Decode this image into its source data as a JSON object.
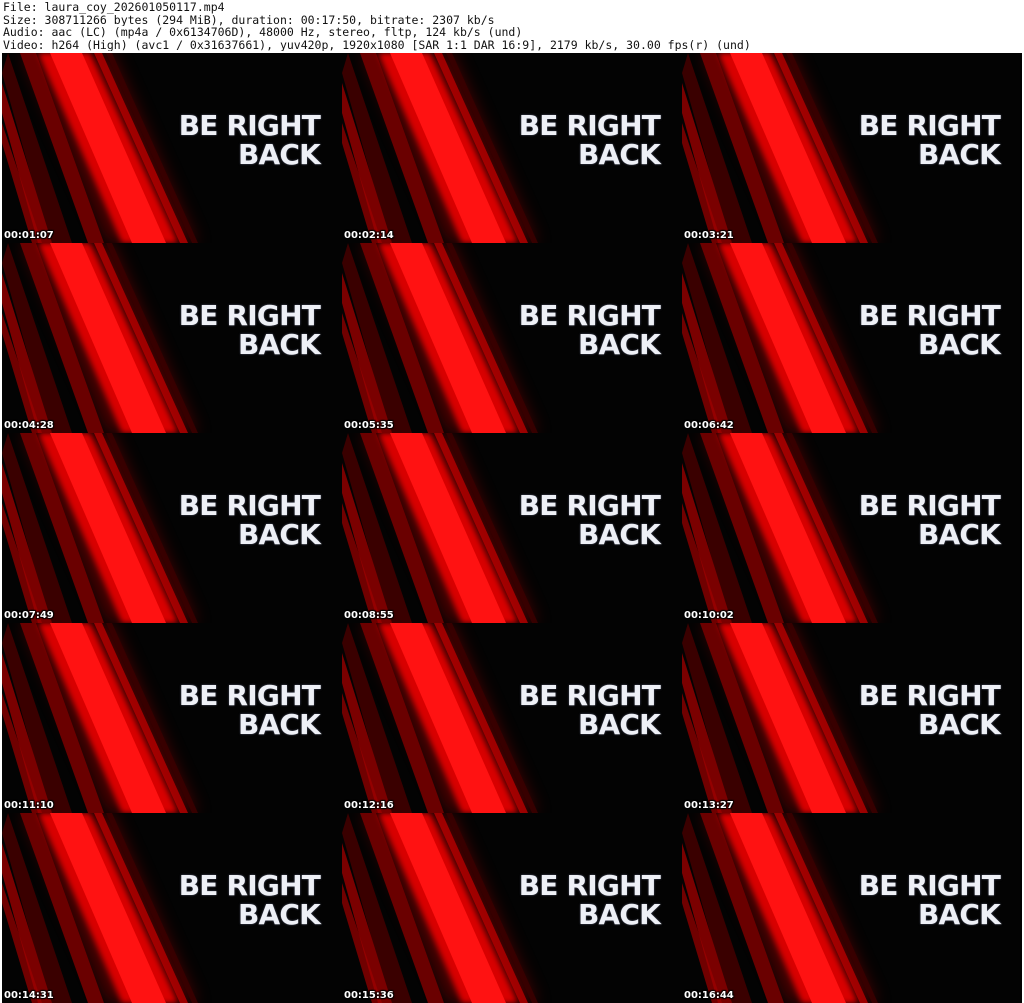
{
  "header": {
    "file": "File: laura_coy_202601050117.mp4",
    "size": "Size: 308711266 bytes (294 MiB), duration: 00:17:50, bitrate: 2307 kb/s",
    "audio": "Audio: aac (LC) (mp4a / 0x6134706D), 48000 Hz, stereo, fltp, 124 kb/s (und)",
    "video": "Video: h264 (High) (avc1 / 0x31637661), yuv420p, 1920x1080 [SAR 1:1 DAR 16:9], 2179 kb/s, 30.00 fps(r) (und)"
  },
  "frames": [
    {
      "line1": "BE RIGHT",
      "line2": "BACK",
      "timestamp": "00:01:07"
    },
    {
      "line1": "BE RIGHT",
      "line2": "BACK",
      "timestamp": "00:02:14"
    },
    {
      "line1": "BE RIGHT",
      "line2": "BACK",
      "timestamp": "00:03:21"
    },
    {
      "line1": "BE RIGHT",
      "line2": "BACK",
      "timestamp": "00:04:28"
    },
    {
      "line1": "BE RIGHT",
      "line2": "BACK",
      "timestamp": "00:05:35"
    },
    {
      "line1": "BE RIGHT",
      "line2": "BACK",
      "timestamp": "00:06:42"
    },
    {
      "line1": "BE RIGHT",
      "line2": "BACK",
      "timestamp": "00:07:49"
    },
    {
      "line1": "BE RIGHT",
      "line2": "BACK",
      "timestamp": "00:08:55"
    },
    {
      "line1": "BE RIGHT",
      "line2": "BACK",
      "timestamp": "00:10:02"
    },
    {
      "line1": "BE RIGHT",
      "line2": "BACK",
      "timestamp": "00:11:10"
    },
    {
      "line1": "BE RIGHT",
      "line2": "BACK",
      "timestamp": "00:12:16"
    },
    {
      "line1": "BE RIGHT",
      "line2": "BACK",
      "timestamp": "00:13:27"
    },
    {
      "line1": "BE RIGHT",
      "line2": "BACK",
      "timestamp": "00:14:31"
    },
    {
      "line1": "BE RIGHT",
      "line2": "BACK",
      "timestamp": "00:15:36"
    },
    {
      "line1": "BE RIGHT",
      "line2": "BACK",
      "timestamp": "00:16:44"
    }
  ],
  "colors": {
    "background": "#030303",
    "stripe_bright": "#ff1010",
    "stripe_mid": "#c00000",
    "stripe_dark": "#5a0000",
    "text": "#eef0f6"
  }
}
